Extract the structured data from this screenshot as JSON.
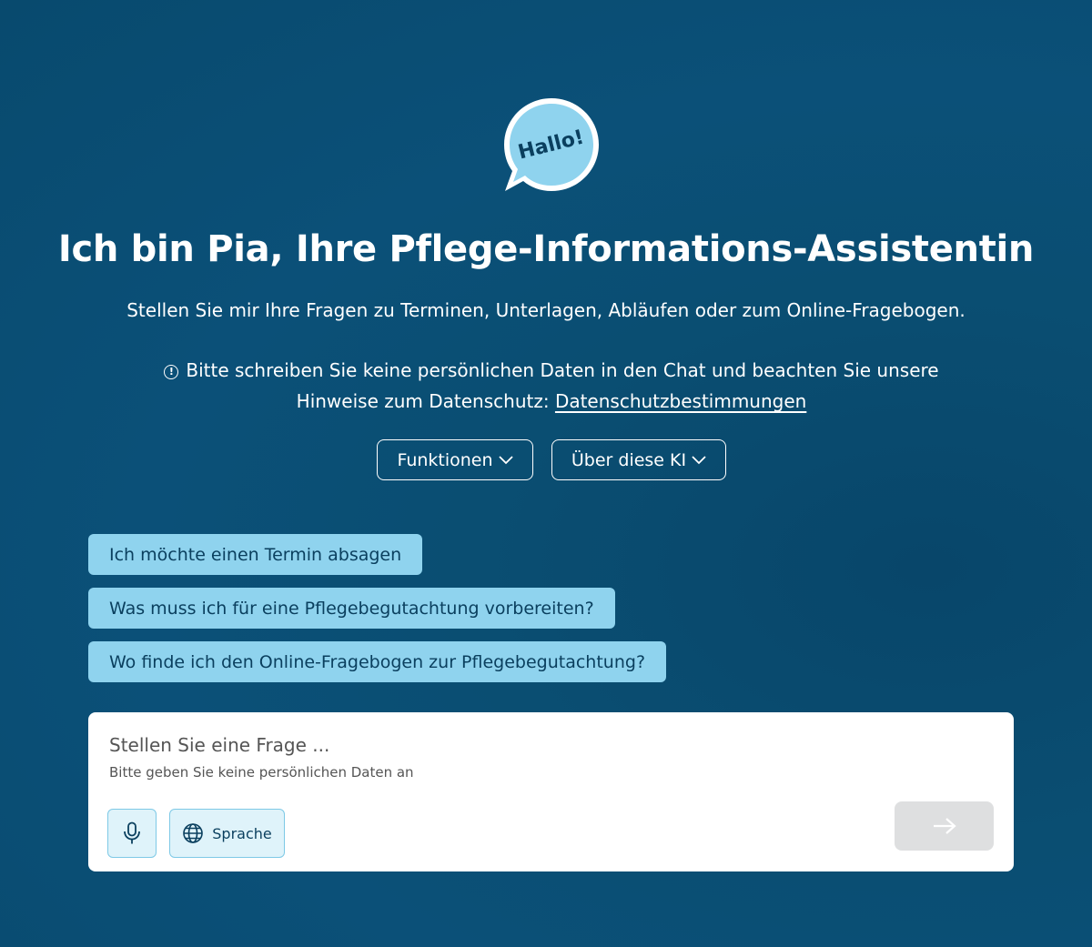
{
  "logo": {
    "text": "Hallo!"
  },
  "header": {
    "title": "Ich bin Pia, Ihre Pflege-Informations-Assistentin",
    "subtitle": "Stellen Sie mir Ihre Fragen zu Terminen, Unterlagen, Abläufen oder zum Online-Fragebogen."
  },
  "notice": {
    "text": "Bitte schreiben Sie keine persönlichen Daten in den Chat und beachten Sie unsere Hinweise zum Datenschutz:",
    "link_label": "Datenschutzbestimmungen",
    "icon": "info-icon"
  },
  "toggles": {
    "functions_label": "Funktionen",
    "about_label": "Über diese KI"
  },
  "suggestions": [
    "Ich möchte einen Termin absagen",
    "Was muss ich für eine Pflegebegutachtung vorbereiten?",
    "Wo finde ich den Online-Fragebogen zur Pflegebegutachtung?"
  ],
  "input": {
    "placeholder": "Stellen Sie eine Frage ...",
    "hint": "Bitte geben Sie keine persönlichen Daten an",
    "language_label": "Sprache"
  },
  "colors": {
    "background": "#0b5078",
    "suggestion_bg": "#8fd3ee",
    "suggestion_text": "#0a3f5e",
    "send_disabled": "#dedfe0"
  }
}
